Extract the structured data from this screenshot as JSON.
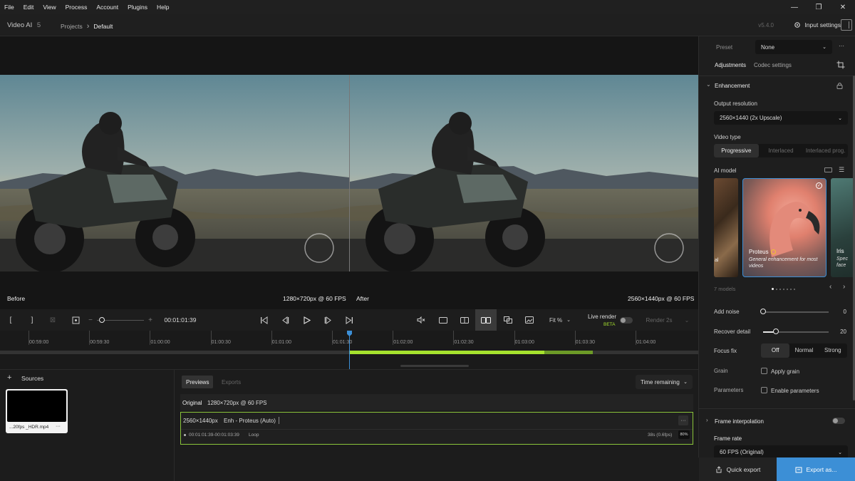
{
  "menu": [
    "File",
    "Edit",
    "View",
    "Process",
    "Account",
    "Plugins",
    "Help"
  ],
  "window": {
    "minimize": "—",
    "maximize": "❐",
    "close": "✕"
  },
  "app": {
    "name": "Video AI",
    "version_major": "5",
    "version": "v5.4.0"
  },
  "breadcrumb": {
    "root": "Projects",
    "separator": "›",
    "current": "Default"
  },
  "header": {
    "input_settings": "Input settings"
  },
  "viewer": {
    "before_label": "Before",
    "before_res": "1280×720px @ 60 FPS",
    "after_label": "After",
    "after_res": "2560×1440px @ 60 FPS"
  },
  "transport": {
    "mark_in": "[",
    "mark_out": "]",
    "clear": "⊠",
    "timecode": "00:01:01:39",
    "zoom_minus": "−",
    "zoom_plus": "+",
    "fit": "Fit %",
    "live_render": "Live render",
    "beta": "BETA",
    "render": "Render 2s"
  },
  "timeline": {
    "ticks": [
      "00:59:00",
      "00:59:30",
      "01:00:00",
      "01:00:30",
      "01:01:00",
      "01:01:30",
      "01:02:00",
      "01:02:30",
      "01:03:00",
      "01:03:30",
      "01:04:00"
    ],
    "playhead_fraction": 0.5
  },
  "sources": {
    "title": "Sources",
    "add": "+",
    "file_name": "...20fps _HDR.mp4",
    "menu": "···"
  },
  "previews": {
    "tab_previews": "Previews",
    "tab_exports": "Exports",
    "sort": "Time remaining",
    "original_label": "Original",
    "original_res": "1280×720px @ 60 FPS",
    "item_res": "2560×1440px",
    "item_model": "Enh - Proteus (Auto)",
    "item_menu": "···",
    "item_range": "00:01:01:39-00:01:03:39",
    "item_loop": "Loop",
    "item_time": "38s (0.6fps)",
    "item_progress": "80%",
    "progress_value": 0.8
  },
  "sidebar": {
    "preset_label": "Preset",
    "preset_value": "None",
    "preset_menu": "···",
    "tab_adjustments": "Adjustments",
    "tab_codec": "Codec settings",
    "section_enhancement": "Enhancement",
    "output_res_label": "Output resolution",
    "output_res_value": "2560×1440 (2x Upscale)",
    "video_type_label": "Video type",
    "video_types": [
      "Progressive",
      "Interlaced",
      "Interlaced prog."
    ],
    "ai_model_label": "AI model",
    "model_left_partial": "al",
    "model_name": "Proteus",
    "model_desc": "General enhancement for most videos",
    "model_right_name": "Iris",
    "model_right_desc": "Spec face",
    "models_count": "7 models",
    "add_noise_label": "Add noise",
    "add_noise_value": "0",
    "add_noise_level": 0,
    "recover_detail_label": "Recover detail",
    "recover_detail_value": "20",
    "recover_detail_level": 0.2,
    "focus_fix_label": "Focus fix",
    "focus_fix_options": [
      "Off",
      "Normal",
      "Strong"
    ],
    "grain_label": "Grain",
    "grain_check": "Apply grain",
    "params_label": "Parameters",
    "params_check": "Enable parameters",
    "frame_interp_label": "Frame interpolation",
    "frame_rate_label": "Frame rate",
    "frame_rate_value": "60 FPS (Original)"
  },
  "actions": {
    "quick_export": "Quick export",
    "export_as": "Export as..."
  },
  "colors": {
    "accent": "#3c8fd6",
    "green": "#a6e22e",
    "outline": "#8ac53a"
  }
}
